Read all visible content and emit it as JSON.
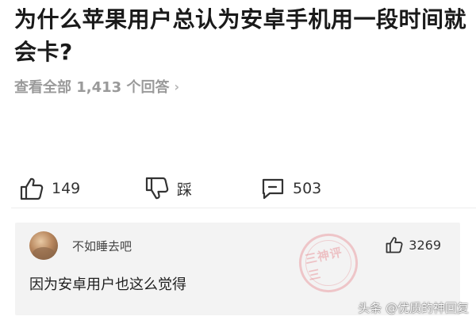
{
  "question": {
    "title": "为什么苹果用户总认为安卓手机用一段时间就会卡?"
  },
  "answers_link": {
    "label": "查看全部 1,413 个回答",
    "chevron": "›"
  },
  "actions": {
    "like_icon": "thumbs-up-icon",
    "like_count": "149",
    "dislike_icon": "thumbs-down-icon",
    "dislike_label": "踩",
    "comment_icon": "comment-icon",
    "comment_count": "503"
  },
  "top_comment": {
    "author": "不如睡去吧",
    "like_count": "3269",
    "text": "因为安卓用户也这么觉得",
    "stamp_text": "三神评三"
  },
  "watermark": {
    "text": "头条 @优质的神回复"
  },
  "colors": {
    "muted_text": "#9a9a9a",
    "card_background": "#f3f3f3",
    "stamp_red": "#e1505a"
  }
}
